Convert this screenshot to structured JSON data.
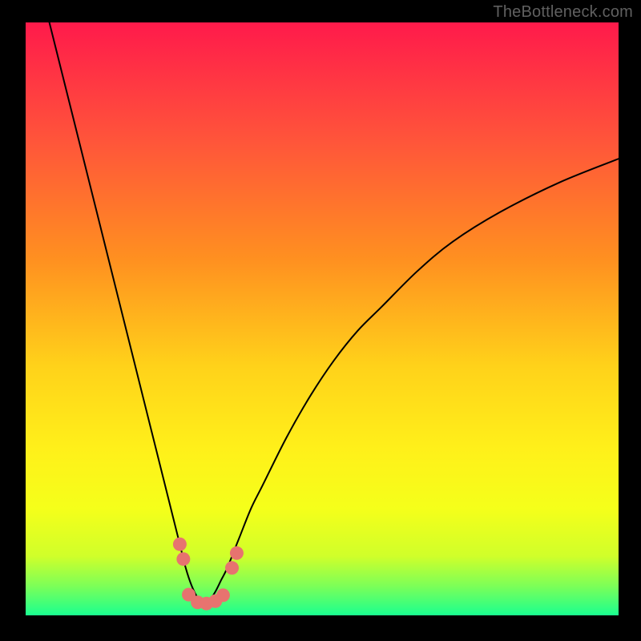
{
  "watermark": "TheBottleneck.com",
  "colors": {
    "background": "#000000",
    "line": "#000000",
    "marker_fill": "#e7736f",
    "gradient_stops": [
      {
        "offset": 0.0,
        "color": "#ff1a4b"
      },
      {
        "offset": 0.2,
        "color": "#ff553a"
      },
      {
        "offset": 0.4,
        "color": "#ff9020"
      },
      {
        "offset": 0.58,
        "color": "#ffd21a"
      },
      {
        "offset": 0.72,
        "color": "#fff01a"
      },
      {
        "offset": 0.82,
        "color": "#f5ff1a"
      },
      {
        "offset": 0.9,
        "color": "#d0ff2a"
      },
      {
        "offset": 0.95,
        "color": "#7dff57"
      },
      {
        "offset": 1.0,
        "color": "#1aff90"
      }
    ]
  },
  "chart_data": {
    "type": "line",
    "title": "",
    "xlabel": "",
    "ylabel": "",
    "xlim": [
      0,
      100
    ],
    "ylim": [
      0,
      100
    ],
    "optimum_x": 30,
    "series": [
      {
        "name": "bottleneck-curve",
        "x": [
          4,
          6,
          8,
          10,
          12,
          14,
          16,
          18,
          20,
          22,
          24,
          26,
          27,
          28,
          29,
          30,
          31,
          32,
          33,
          34,
          36,
          38,
          40,
          44,
          48,
          52,
          56,
          60,
          66,
          72,
          80,
          90,
          100
        ],
        "values": [
          100,
          92,
          84,
          76,
          68,
          60,
          52,
          44,
          36,
          28,
          20,
          12,
          8,
          5,
          3,
          2,
          2.5,
          4,
          6,
          8,
          13,
          18,
          22,
          30,
          37,
          43,
          48,
          52,
          58,
          63,
          68,
          73,
          77
        ]
      }
    ],
    "markers": [
      {
        "x": 26.0,
        "y": 12.0
      },
      {
        "x": 26.6,
        "y": 9.5
      },
      {
        "x": 27.5,
        "y": 3.5
      },
      {
        "x": 29.0,
        "y": 2.2
      },
      {
        "x": 30.5,
        "y": 2.0
      },
      {
        "x": 32.0,
        "y": 2.4
      },
      {
        "x": 33.3,
        "y": 3.4
      },
      {
        "x": 34.8,
        "y": 8.0
      },
      {
        "x": 35.6,
        "y": 10.5
      }
    ],
    "marker_radius_px": 8.5
  }
}
